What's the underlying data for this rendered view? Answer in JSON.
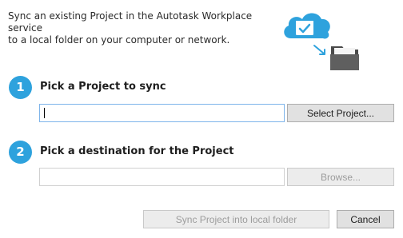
{
  "intro": {
    "line1": "Sync an existing Project in the Autotask Workplace service",
    "line2": "to a local folder on your computer or network."
  },
  "illustration": {
    "cloud_icon": "cloud-check-icon",
    "arrow_icon": "arrow-down-right-icon",
    "folder_icon": "folder-icon",
    "accent_color": "#2ea2dd",
    "folder_color": "#5a5a5a"
  },
  "step1": {
    "number": "1",
    "title": "Pick a Project to sync",
    "input_value": "",
    "button_label": "Select Project..."
  },
  "step2": {
    "number": "2",
    "title": "Pick a destination for the Project",
    "input_value": "",
    "button_label": "Browse..."
  },
  "footer": {
    "sync_label": "Sync Project into local folder",
    "cancel_label": "Cancel"
  }
}
